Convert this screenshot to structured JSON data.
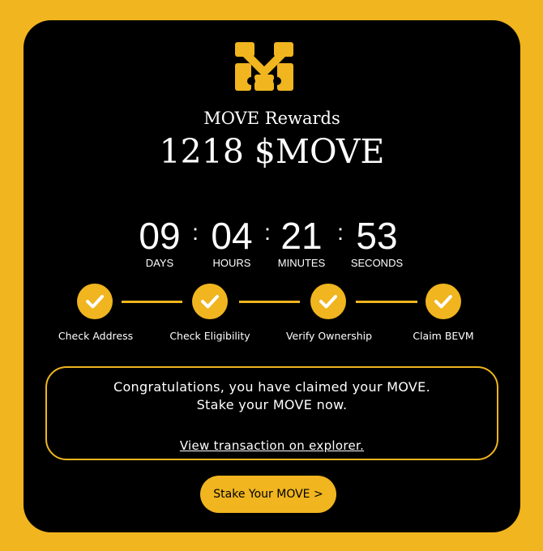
{
  "brand": {
    "accent_color": "#f0b51f",
    "logo_icon": "move-logo-icon"
  },
  "rewards": {
    "label": "MOVE Rewards",
    "amount": "1218 $MOVE"
  },
  "countdown": [
    {
      "value": "09",
      "label": "DAYS"
    },
    {
      "value": "04",
      "label": "HOURS"
    },
    {
      "value": "21",
      "label": "MINUTES"
    },
    {
      "value": "53",
      "label": "SECONDS"
    }
  ],
  "countdown_separator": ":",
  "steps": [
    {
      "label": "Check Address",
      "icon": "check-icon"
    },
    {
      "label": "Check Eligibility",
      "icon": "check-icon"
    },
    {
      "label": "Verify Ownership",
      "icon": "check-icon"
    },
    {
      "label": "Claim BEVM",
      "icon": "check-icon"
    }
  ],
  "notice": {
    "line1": "Congratulations, you have claimed your MOVE.",
    "line2": "Stake your MOVE now.",
    "link": "View transaction on explorer."
  },
  "stake_button": {
    "label": "Stake Your MOVE >"
  }
}
